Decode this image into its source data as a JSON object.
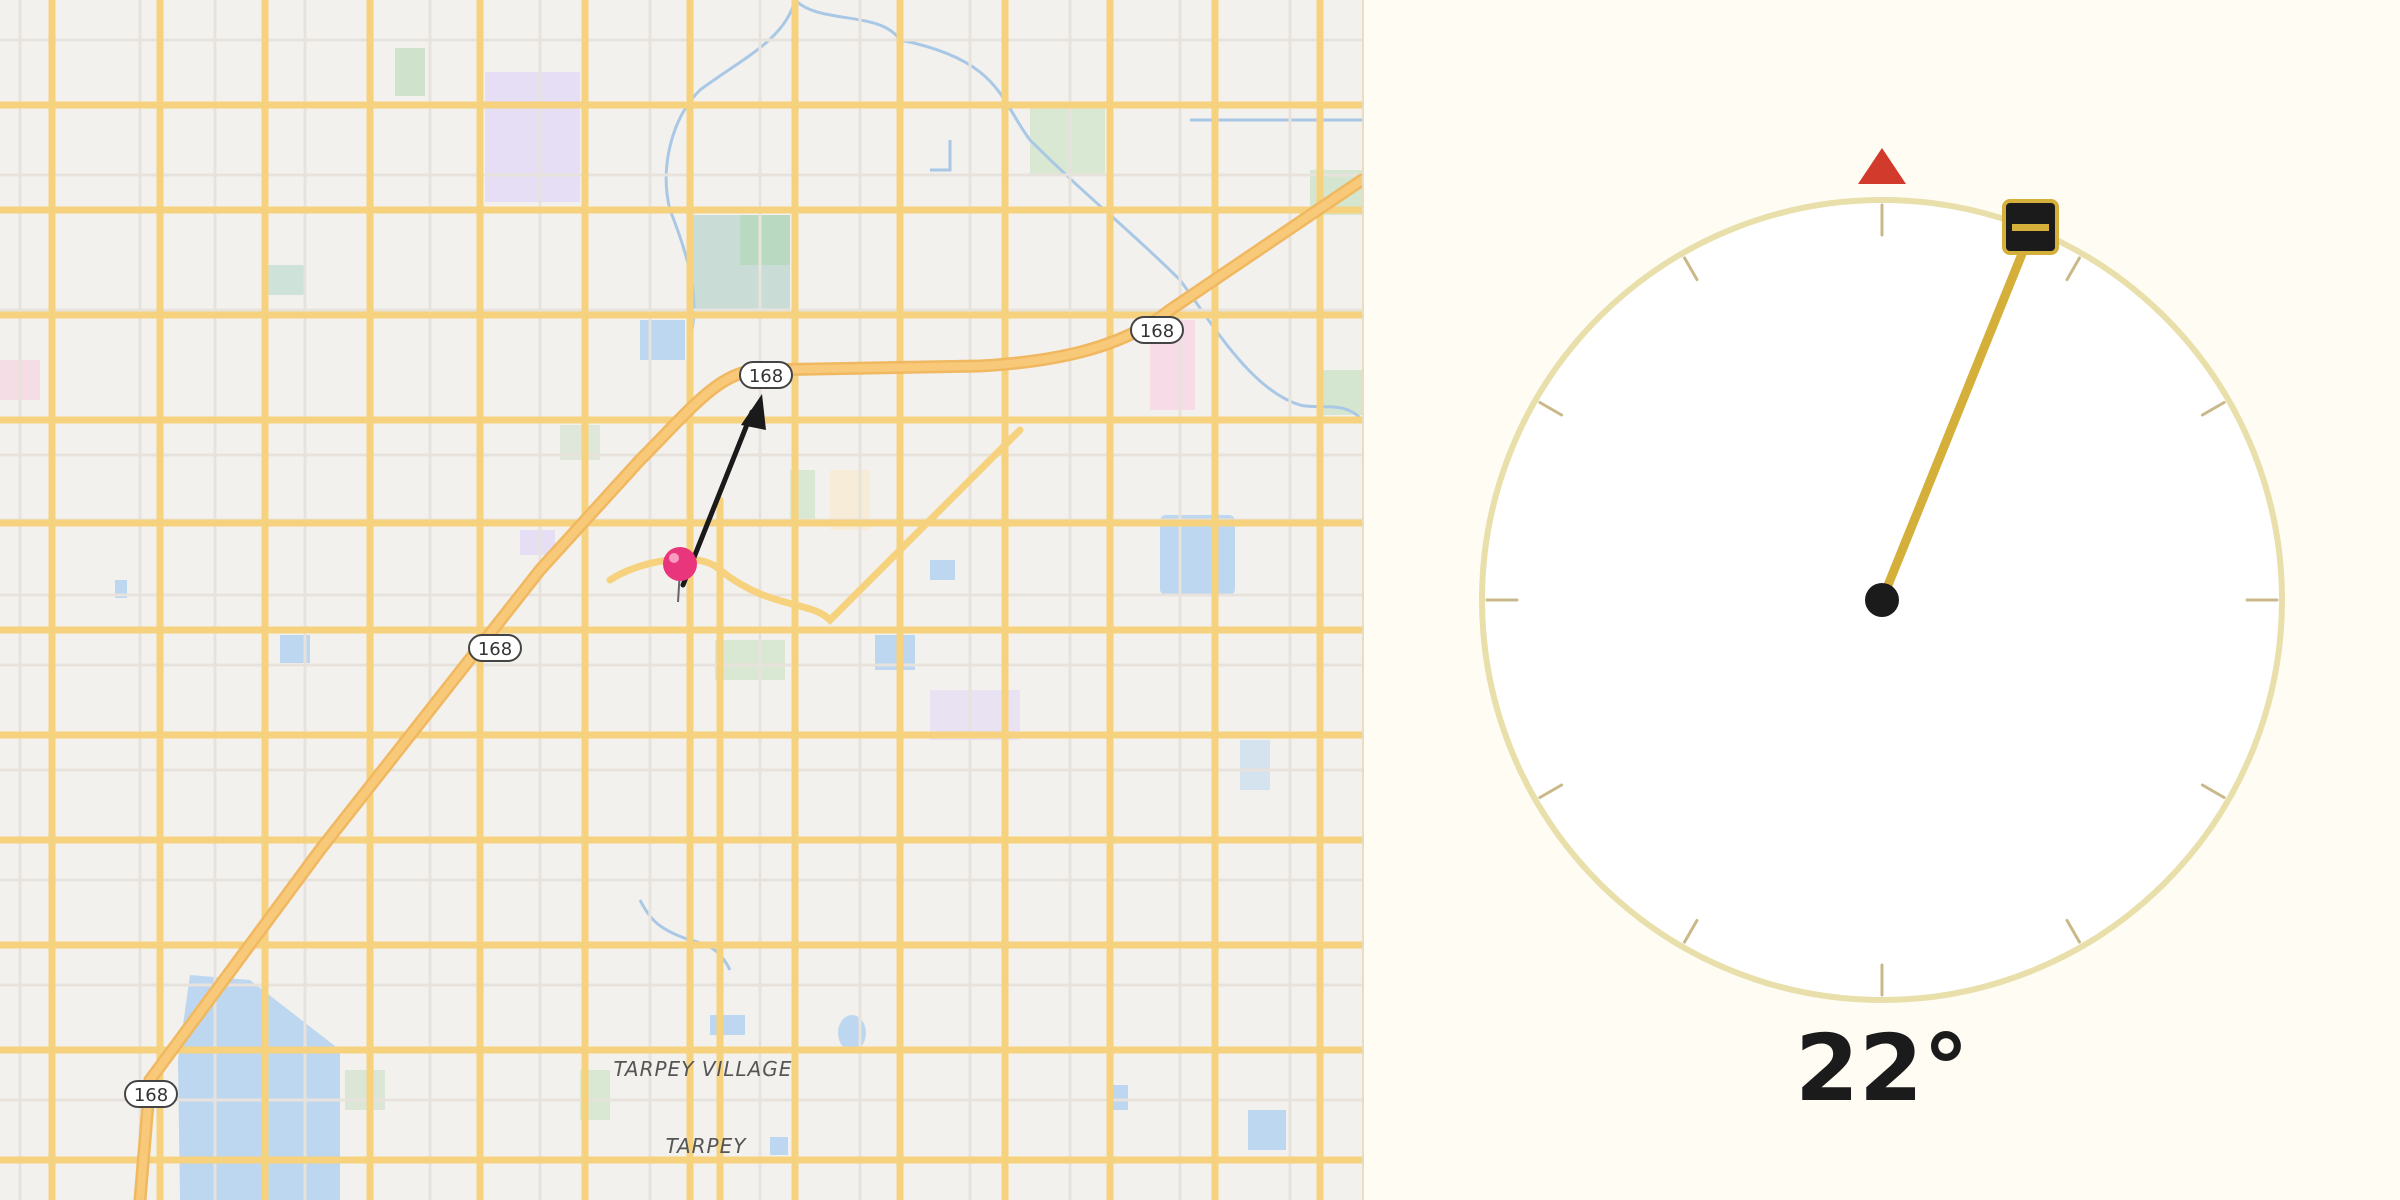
{
  "map": {
    "highway_route_number": "168",
    "route_shields": [
      "168",
      "168",
      "168",
      "168"
    ],
    "place_labels": [
      "TARPEY VILLAGE",
      "TARPEY"
    ],
    "pin_color": "#e8357c",
    "road_color": "#f6d27e",
    "water_color": "#bcd7ef"
  },
  "compass": {
    "heading_deg": 22,
    "heading_label": "22°",
    "north_marker_color": "#d23a2c",
    "needle_color": "#d4af3a"
  }
}
